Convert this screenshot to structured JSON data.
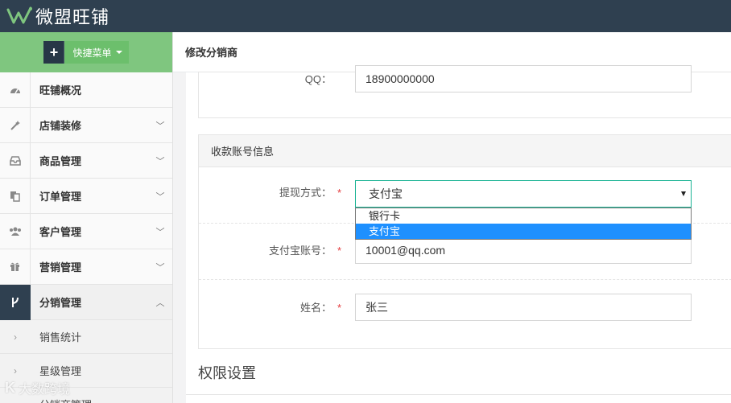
{
  "app": {
    "logo_text": "微盟旺铺"
  },
  "sidebar": {
    "quick_menu": "快捷菜单",
    "items": [
      {
        "label": "旺铺概况",
        "icon": "dashboard-icon"
      },
      {
        "label": "店铺装修",
        "icon": "magic-wand-icon"
      },
      {
        "label": "商品管理",
        "icon": "inbox-icon"
      },
      {
        "label": "订单管理",
        "icon": "copy-icon"
      },
      {
        "label": "客户管理",
        "icon": "users-icon"
      },
      {
        "label": "营销管理",
        "icon": "gift-icon"
      },
      {
        "label": "分销管理",
        "icon": "branch-icon"
      }
    ],
    "sub_items": [
      {
        "label": "销售统计"
      },
      {
        "label": "星级管理"
      },
      {
        "label": "分销商管理"
      }
    ]
  },
  "page": {
    "title": "修改分销商"
  },
  "form": {
    "qq": {
      "label": "QQ：",
      "value": "18900000000"
    },
    "account_section": {
      "title": "收款账号信息"
    },
    "withdraw": {
      "label": "提现方式：",
      "required": "*",
      "value": "支付宝",
      "options": [
        "银行卡",
        "支付宝"
      ]
    },
    "alipay": {
      "label": "支付宝账号：",
      "required": "*",
      "value": "10001@qq.com"
    },
    "name": {
      "label": "姓名：",
      "required": "*",
      "value": "张三"
    },
    "permission_section": {
      "title": "权限设置"
    }
  },
  "watermark": {
    "logo": "K",
    "text": "大数跨境"
  },
  "colors": {
    "topbar": "#2f4050",
    "sidebar_header": "#7fc67f",
    "focus": "#1ab394",
    "selected": "#1e90ff",
    "required": "#e4393c"
  }
}
